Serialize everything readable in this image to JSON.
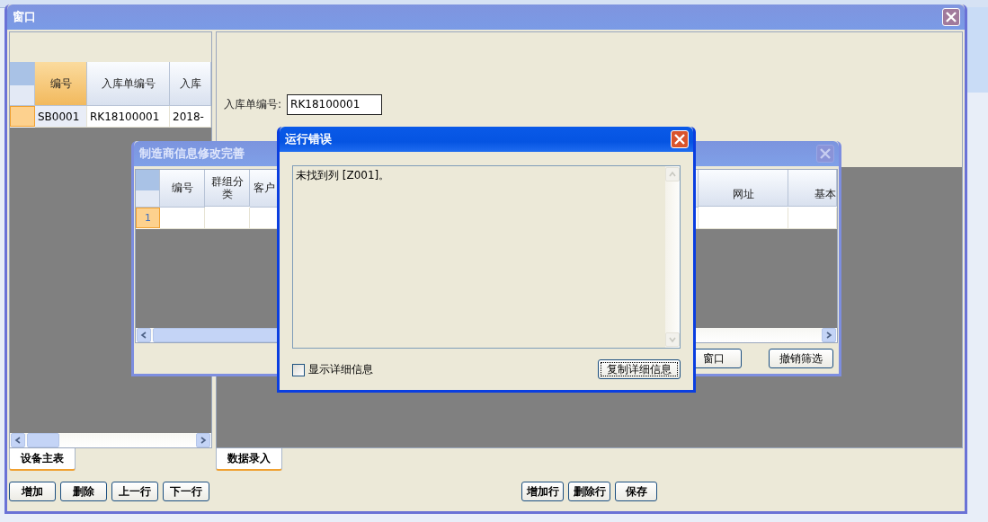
{
  "main_window": {
    "title": "窗口"
  },
  "left_panel": {
    "columns": [
      {
        "label": "编号",
        "selected": true
      },
      {
        "label": "入库单编号",
        "selected": false
      },
      {
        "label": "入库",
        "selected": false
      }
    ],
    "rows": [
      {
        "cells": [
          "SB0001",
          "RK18100001",
          "2018-"
        ],
        "selected": true
      }
    ],
    "tab": "设备主表",
    "buttons": [
      "增加",
      "删除",
      "上一行",
      "下一行"
    ]
  },
  "right_panel": {
    "field": {
      "label": "入库单编号:",
      "value": "RK18100001"
    },
    "tab": "数据录入",
    "buttons": [
      "增加行",
      "删除行",
      "保存"
    ]
  },
  "manufacturer_dialog": {
    "title": "制造商信息修改完善",
    "columns": [
      "编号",
      "群组分类",
      "客户"
    ],
    "right_columns": [
      "网址",
      "基本"
    ],
    "row_number": "1",
    "buttons": [
      "窗口",
      "撤销筛选"
    ]
  },
  "error_dialog": {
    "title": "运行错误",
    "message": "未找到列 [Z001]。",
    "checkbox": {
      "label": "显示详细信息",
      "checked": false
    },
    "button": "复制详细信息"
  }
}
